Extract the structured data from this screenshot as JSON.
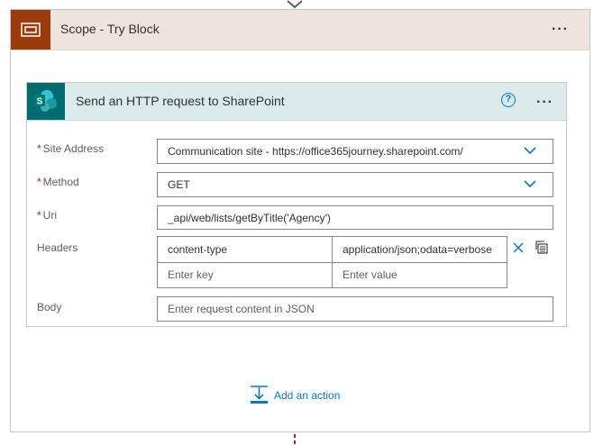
{
  "scope": {
    "title": "Scope - Try Block",
    "more_label": "···"
  },
  "action": {
    "title": "Send an HTTP request to SharePoint",
    "help_label": "?",
    "more_label": "···",
    "fields": {
      "site_address": {
        "label": "Site Address",
        "required_mark": "*",
        "value": "Communication site - https://office365journey.sharepoint.com/"
      },
      "method": {
        "label": "Method",
        "required_mark": "*",
        "value": "GET"
      },
      "uri": {
        "label": "Uri",
        "required_mark": "*",
        "value": "_api/web/lists/getByTitle('Agency')"
      },
      "headers": {
        "label": "Headers",
        "rows": [
          {
            "key": "content-type",
            "value": "application/json;odata=verbose"
          }
        ],
        "key_placeholder": "Enter key",
        "value_placeholder": "Enter value"
      },
      "body": {
        "label": "Body",
        "placeholder": "Enter request content in JSON"
      }
    }
  },
  "add_action_label": "Add an action",
  "colors": {
    "scope_accent": "#9b3a0a",
    "scope_header_bg": "#efe3de",
    "sharepoint_accent": "#036c70",
    "card_header_bg": "#dbebec",
    "link_blue": "#0078d4",
    "required_red": "#a4262c"
  }
}
